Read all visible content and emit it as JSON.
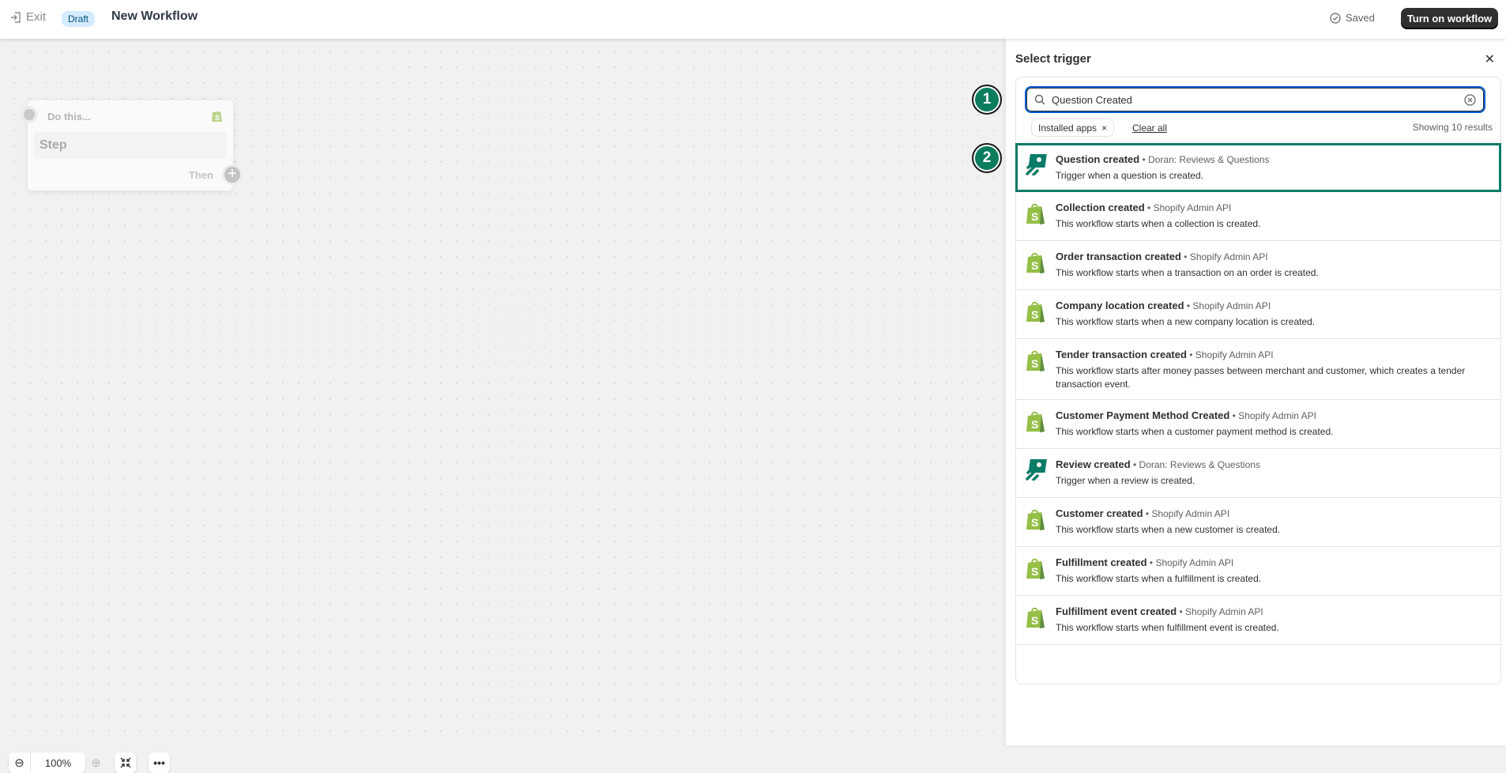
{
  "header": {
    "exit_label": "Exit",
    "status_badge": "Draft",
    "title": "New Workflow",
    "saved_label": "Saved",
    "turn_on_label": "Turn on workflow"
  },
  "canvas": {
    "node": {
      "header": "Do this...",
      "step": "Step",
      "then": "Then"
    },
    "zoom_level": "100%"
  },
  "panel": {
    "title": "Select trigger",
    "search": {
      "value": "Question Created",
      "placeholder": ""
    },
    "filter_chip": "Installed apps",
    "clear_all": "Clear all",
    "results_count": "Showing 10 results",
    "results": [
      {
        "name": "Question created",
        "source": "Doran: Reviews & Questions",
        "desc": "Trigger when a question is created.",
        "icon": "doran-icon",
        "selected": true
      },
      {
        "name": "Collection created",
        "source": "Shopify Admin API",
        "desc": "This workflow starts when a collection is created.",
        "icon": "shopify-icon"
      },
      {
        "name": "Order transaction created",
        "source": "Shopify Admin API",
        "desc": "This workflow starts when a transaction on an order is created.",
        "icon": "shopify-icon"
      },
      {
        "name": "Company location created",
        "source": "Shopify Admin API",
        "desc": "This workflow starts when a new company location is created.",
        "icon": "shopify-icon"
      },
      {
        "name": "Tender transaction created",
        "source": "Shopify Admin API",
        "desc": "This workflow starts after money passes between merchant and customer, which creates a tender transaction event.",
        "icon": "shopify-icon"
      },
      {
        "name": "Customer Payment Method Created",
        "source": "Shopify Admin API",
        "desc": "This workflow starts when a customer payment method is created.",
        "icon": "shopify-icon"
      },
      {
        "name": "Review created",
        "source": "Doran: Reviews & Questions",
        "desc": "Trigger when a review is created.",
        "icon": "doran-icon"
      },
      {
        "name": "Customer created",
        "source": "Shopify Admin API",
        "desc": "This workflow starts when a new customer is created.",
        "icon": "shopify-icon"
      },
      {
        "name": "Fulfillment created",
        "source": "Shopify Admin API",
        "desc": "This workflow starts when a fulfillment is created.",
        "icon": "shopify-icon"
      },
      {
        "name": "Fulfillment event created",
        "source": "Shopify Admin API",
        "desc": "This workflow starts when fulfillment event is created.",
        "icon": "shopify-icon"
      }
    ]
  },
  "markers": [
    "1",
    "2"
  ],
  "colors": {
    "accent": "#0c7c5f",
    "focus": "#005bd3",
    "shopify": "#95bf47"
  }
}
